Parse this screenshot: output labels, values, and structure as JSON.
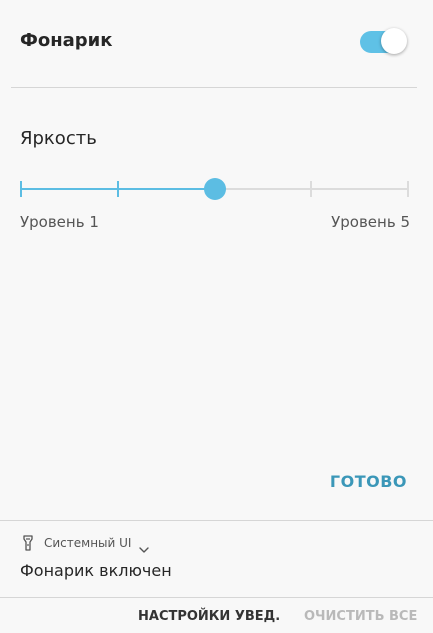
{
  "flashlight": {
    "title": "Фонарик",
    "enabled": true
  },
  "brightness": {
    "label": "Яркость",
    "min_label": "Уровень 1",
    "max_label": "Уровень 5",
    "levels": 5,
    "current_level": 3
  },
  "done_label": "ГОТОВО",
  "notification": {
    "app_name": "Системный UI",
    "app_icon": "flashlight-icon",
    "expand_icon": "chevron-down-icon",
    "text": "Фонарик включен"
  },
  "actions": {
    "notif_settings_label": "НАСТРОЙКИ УВЕД.",
    "clear_all_label": "ОЧИСТИТЬ ВСЕ"
  },
  "colors": {
    "accent": "#5cbde3",
    "toggle_on": "#5fc1e6",
    "done_text": "#3b97b8",
    "track_inactive": "#dcdcdc",
    "disabled_text": "#b9b9b9"
  }
}
